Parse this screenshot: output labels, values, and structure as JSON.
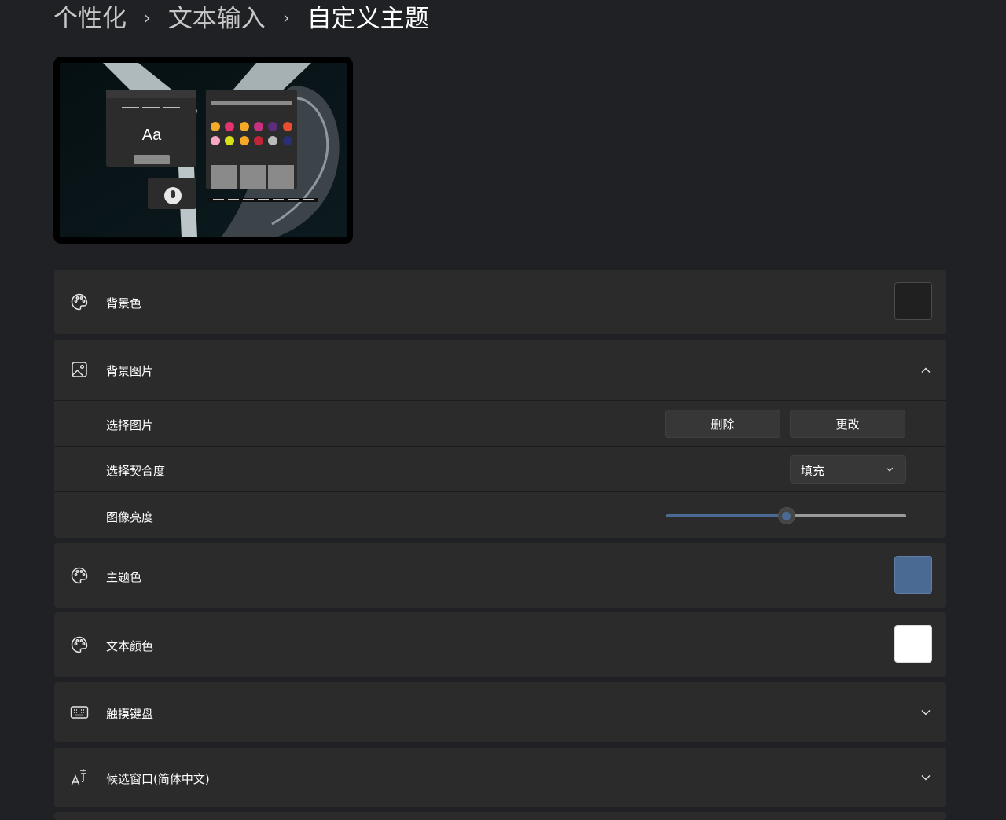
{
  "breadcrumb": {
    "items": [
      "个性化",
      "文本输入",
      "自定义主题"
    ]
  },
  "preview": {
    "sample_text": "Aa",
    "dot_colors_row1": [
      "#f6a927",
      "#e5336f",
      "#f6a927",
      "#c9317e",
      "#5c2d7a",
      "#e94c2e"
    ],
    "dot_colors_row2": [
      "#f7a6c4",
      "#d8e01b",
      "#f6a927",
      "#c02538",
      "#bbbbbb",
      "#2b2e78"
    ]
  },
  "settings": {
    "background_color": {
      "label": "背景色",
      "icon": "palette-icon",
      "swatch": "#202020"
    },
    "background_image": {
      "label": "背景图片",
      "icon": "image-icon",
      "expanded": true,
      "choose_picture": {
        "label": "选择图片",
        "delete_label": "删除",
        "change_label": "更改"
      },
      "choose_fit": {
        "label": "选择契合度",
        "value": "填充"
      },
      "image_brightness": {
        "label": "图像亮度",
        "value_fraction": 0.5
      }
    },
    "accent_color": {
      "label": "主题色",
      "icon": "palette-icon",
      "swatch": "#4a6a93"
    },
    "text_color": {
      "label": "文本颜色",
      "icon": "palette-icon",
      "swatch": "#ffffff"
    },
    "touch_keyboard": {
      "label": "触摸键盘",
      "icon": "keyboard-icon"
    },
    "candidate_window": {
      "label": "候选窗口(简体中文)",
      "icon": "ime-icon"
    }
  },
  "colors": {
    "accent": "#4a6a93",
    "background": "#202124",
    "card": "#2b2b2b"
  }
}
